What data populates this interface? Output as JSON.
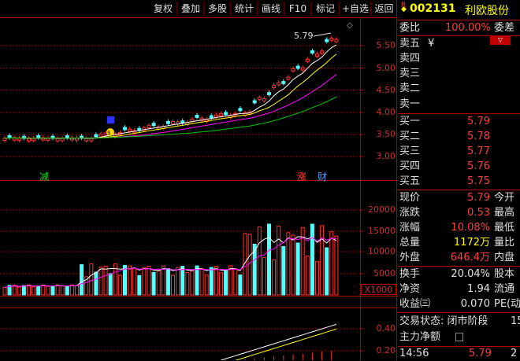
{
  "toolbar": {
    "items": [
      "复权",
      "叠加",
      "多股",
      "统计",
      "画线",
      "F10",
      "标记",
      "+自选",
      "返回"
    ]
  },
  "stock": {
    "badge": "R",
    "code": "002131",
    "name": "利欧股份"
  },
  "chart": {
    "max_label": "5.79",
    "marker_jian": "减",
    "marker_zhang": "涨",
    "marker_cai": "财",
    "price_axis": [
      "5.50",
      "5.00",
      "4.50",
      "4.00",
      "3.50",
      "3.00"
    ],
    "volume_axis": [
      "20000",
      "15000",
      "10000",
      "5000"
    ],
    "volume_unit": "X1000",
    "indicator_axis": [
      "0.40",
      "0.20"
    ],
    "colors": {
      "up": "#ff3232",
      "down": "#54ffff",
      "ma5": "#ffffff",
      "ma10": "#ffff00",
      "ma20": "#ff00ff",
      "ma60": "#00c800",
      "grid": "#b00000"
    }
  },
  "quote": {
    "wei_label": "委比",
    "wei_value": "100.00%",
    "wei_diff_label": "委差",
    "sell": [
      {
        "label": "卖五",
        "price": "¥"
      },
      {
        "label": "卖四",
        "price": ""
      },
      {
        "label": "卖三",
        "price": ""
      },
      {
        "label": "卖二",
        "price": ""
      },
      {
        "label": "卖一",
        "price": ""
      }
    ],
    "buy": [
      {
        "label": "买一",
        "price": "5.79"
      },
      {
        "label": "买二",
        "price": "5.78"
      },
      {
        "label": "买三",
        "price": "5.77"
      },
      {
        "label": "买四",
        "price": "5.76"
      },
      {
        "label": "买五",
        "price": "5.75"
      }
    ],
    "stats": [
      {
        "label": "现价",
        "value": "5.79",
        "label2": "今开"
      },
      {
        "label": "涨跌",
        "value": "0.53",
        "label2": "最高"
      },
      {
        "label": "涨幅",
        "value": "10.08%",
        "label2": "最低"
      },
      {
        "label": "总量",
        "value": "1172万",
        "label2": "量比"
      },
      {
        "label": "外盘",
        "value": "646.4万",
        "label2": "内盘"
      }
    ],
    "stats2": [
      {
        "label": "换手",
        "value": "20.04%",
        "label2": "股本"
      },
      {
        "label": "净资",
        "value": "1.94",
        "label2": "流通"
      },
      {
        "label": "收益㈢",
        "value": "0.070",
        "label2": "PE(动"
      }
    ],
    "status_label": "交易状态: 闭市阶段",
    "status_extra": "15",
    "net_label": "主力净额",
    "tick_time": "14:56",
    "tick_price": "5.79",
    "tick_extra": "2"
  }
}
